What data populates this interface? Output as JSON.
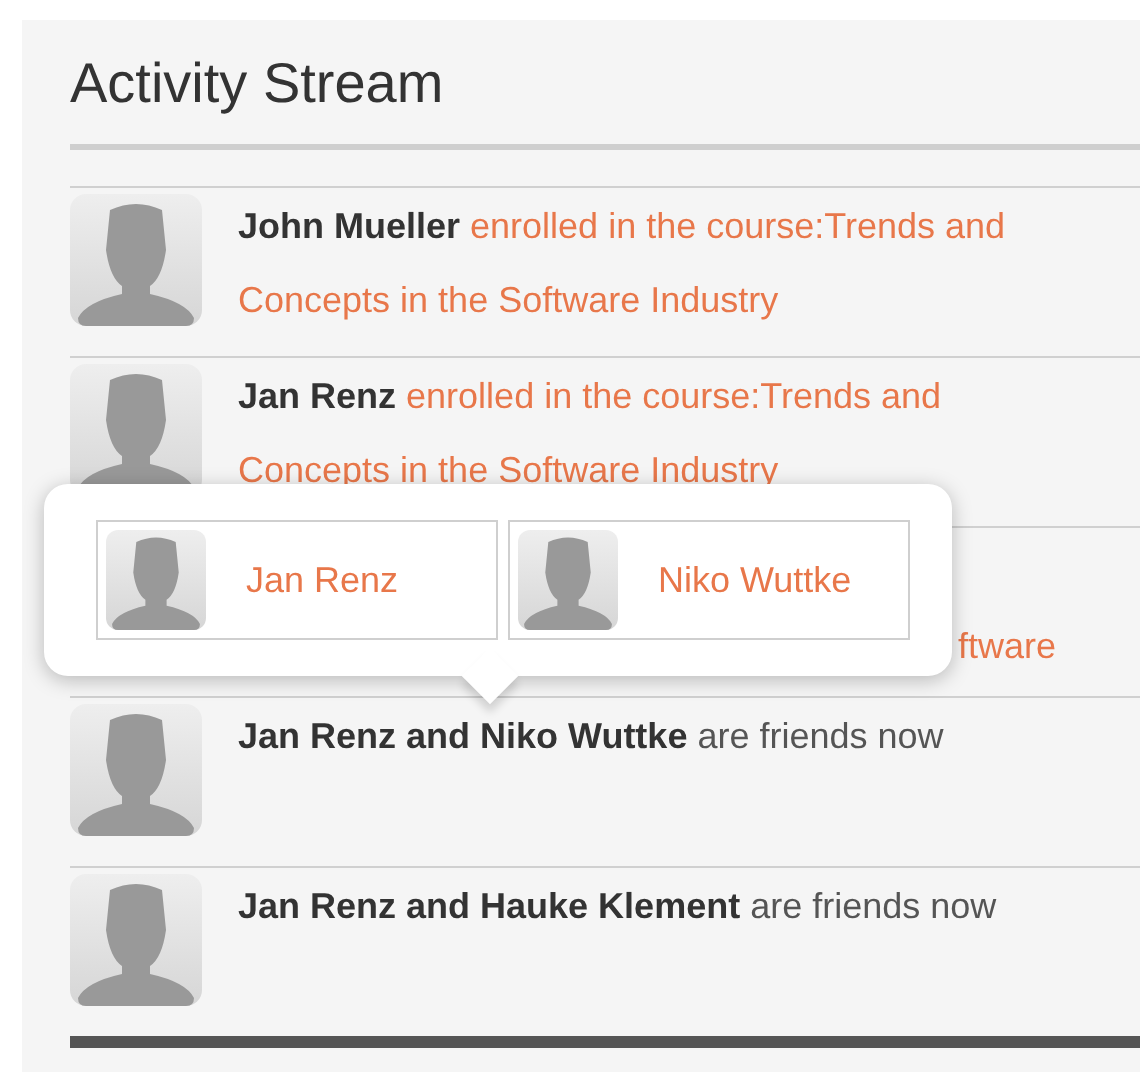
{
  "title": "Activity Stream",
  "activities": [
    {
      "kind": "enrollment",
      "actor": "John Mueller",
      "action": "enrolled in the course:Trends and Concepts in the Software Industry"
    },
    {
      "kind": "enrollment",
      "actor": "Jan Renz",
      "action": "enrolled in the course:Trends and Concepts in the Software Industry"
    },
    {
      "kind": "partial",
      "text": "ftware"
    },
    {
      "kind": "friendship",
      "actor": "Jan Renz and Niko Wuttke",
      "action": "are friends now"
    },
    {
      "kind": "friendship",
      "actor": "Jan Renz and Hauke Klement",
      "action": "are friends now"
    }
  ],
  "popover": {
    "people": [
      {
        "name": "Jan Renz"
      },
      {
        "name": "Niko Wuttke"
      }
    ]
  }
}
